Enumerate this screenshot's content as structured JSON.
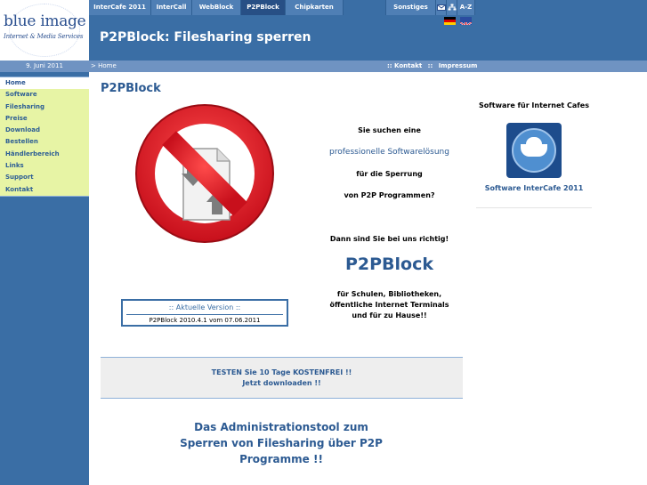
{
  "logo": {
    "line1": "blue image",
    "line2": "Internet & Media Services"
  },
  "date": "9. Juni 2011",
  "nav": {
    "tabs": [
      {
        "label": "InterCafe 2011"
      },
      {
        "label": "InterCall"
      },
      {
        "label": "WebBlock"
      },
      {
        "label": "P2PBlock"
      },
      {
        "label": "Chipkarten"
      },
      {
        "label": "Sonstiges"
      },
      {
        "label": "A-Z"
      }
    ],
    "active": "P2PBlock"
  },
  "header": {
    "title": "P2PBlock: Filesharing sperren"
  },
  "breadcrumb": {
    "home": "> Home",
    "kontakt": ":: Kontakt",
    "sep": "::",
    "impressum": "Impressum"
  },
  "sidebar": {
    "items": [
      {
        "label": "Home"
      },
      {
        "label": "Software"
      },
      {
        "label": "Filesharing"
      },
      {
        "label": "Preise"
      },
      {
        "label": "Download"
      },
      {
        "label": "Bestellen"
      },
      {
        "label": "Händlerbereich"
      },
      {
        "label": "Links"
      },
      {
        "label": "Support"
      },
      {
        "label": "Kontakt"
      }
    ]
  },
  "content": {
    "title": "P2PBlock",
    "version_title": ":: Aktuelle Version ::",
    "version_text": "P2PBlock 2010.4.1 vom 07.06.2011",
    "mid_l1": "Sie suchen eine",
    "mid_l2": "professionelle Softwarelösung",
    "mid_l3": "für die Sperrung",
    "mid_l4": "von P2P Programmen?",
    "mid_l5": "Dann sind Sie bei uns richtig!",
    "mid_big": "P2PBlock",
    "mid_l6a": "für Schulen, Bibliotheken,",
    "mid_l6b": "öffentliche Internet Terminals",
    "mid_l6c": "und für zu Hause!!",
    "test_l1": "TESTEN Sie 10 Tage KOSTENFREI !!",
    "test_l2": "Jetzt downloaden !!",
    "admin_text": "Das Administrationstool zum Sperren von Filesharing über P2P Programme !!"
  },
  "right": {
    "title": "Software für Internet Cafes",
    "link": "Software InterCafe 2011"
  },
  "colors": {
    "primary_blue": "#3a6ea5",
    "sidebar_green": "#e7f4a5",
    "prohibited_red": "#e8202a"
  }
}
